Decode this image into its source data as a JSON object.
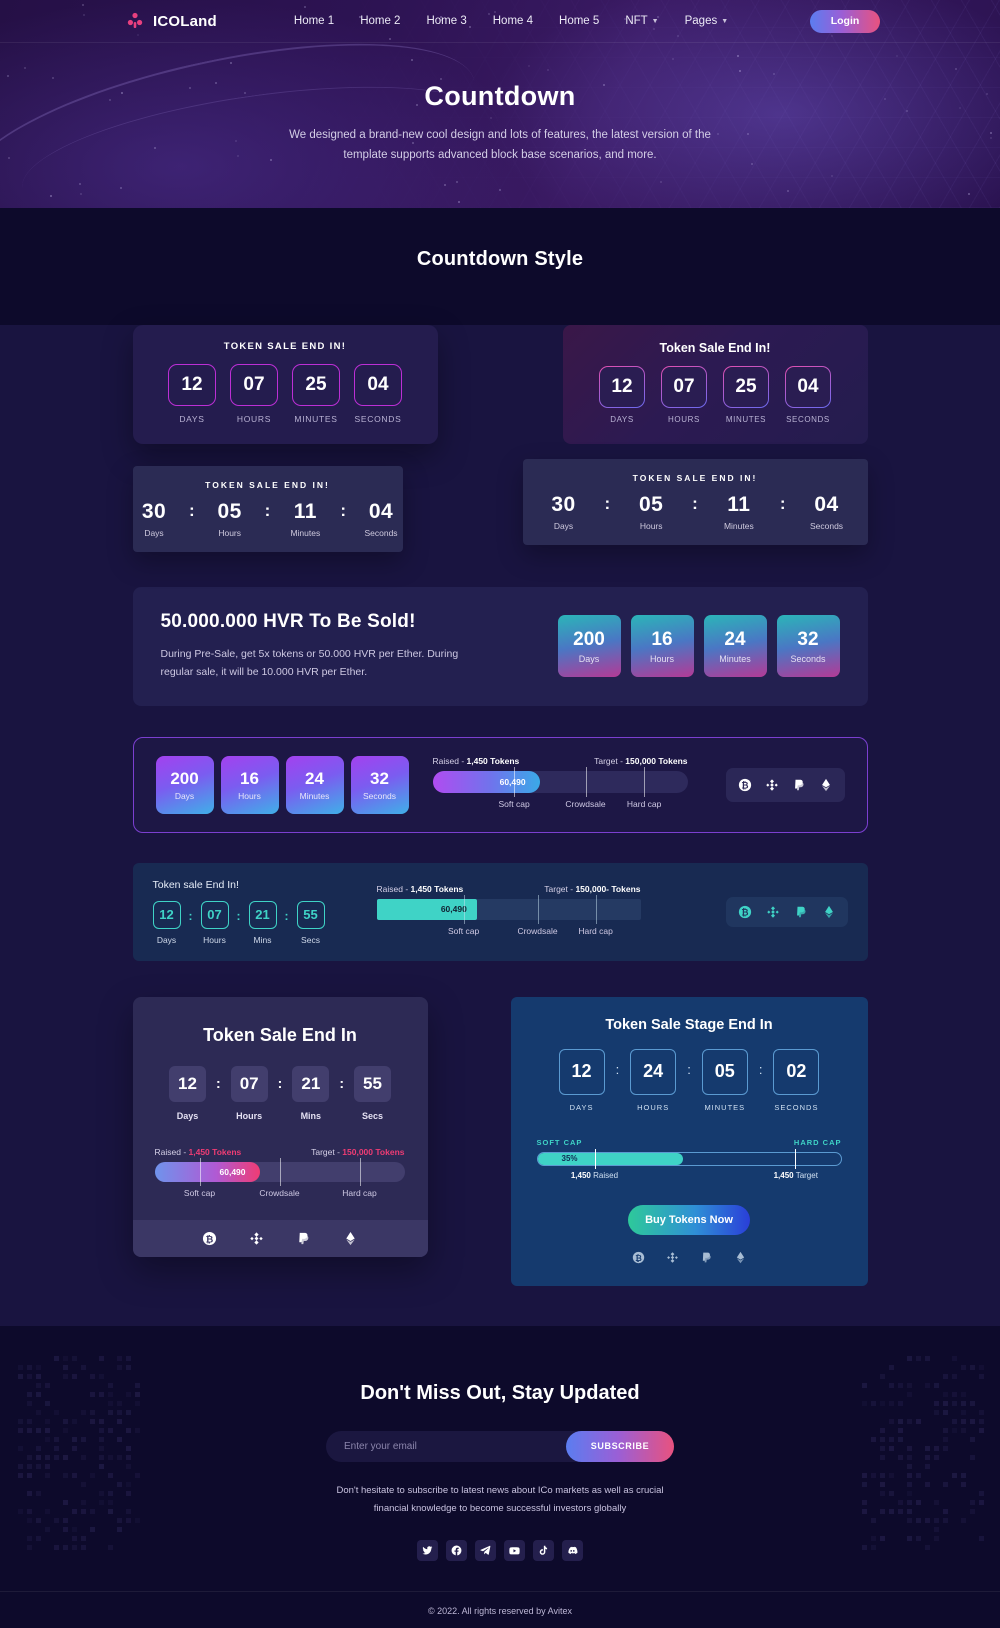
{
  "nav": {
    "brand": "ICOLand",
    "links": [
      {
        "label": "Home 1",
        "caret": false
      },
      {
        "label": "Home 2",
        "caret": false
      },
      {
        "label": "Home 3",
        "caret": false
      },
      {
        "label": "Home 4",
        "caret": false
      },
      {
        "label": "Home 5",
        "caret": false
      },
      {
        "label": "NFT",
        "caret": true
      },
      {
        "label": "Pages",
        "caret": true
      }
    ],
    "login": "Login"
  },
  "hero": {
    "title": "Countdown",
    "subtitle": "We designed a brand-new cool design and lots of features, the latest version of the template supports advanced block base scenarios, and more."
  },
  "section": {
    "title": "Countdown Style"
  },
  "card1": {
    "title": "TOKEN SALE END IN!",
    "units": [
      {
        "value": "12",
        "label": "DAYS"
      },
      {
        "value": "07",
        "label": "HOURS"
      },
      {
        "value": "25",
        "label": "MINUTES"
      },
      {
        "value": "04",
        "label": "SECONDS"
      }
    ]
  },
  "card2": {
    "title": "Token Sale End In!",
    "units": [
      {
        "value": "12",
        "label": "DAYS"
      },
      {
        "value": "07",
        "label": "HOURS"
      },
      {
        "value": "25",
        "label": "MINUTES"
      },
      {
        "value": "04",
        "label": "SECONDS"
      }
    ]
  },
  "card3": {
    "title": "TOKEN SALE END IN!",
    "separator": ":",
    "units": [
      {
        "value": "30",
        "label": "Days"
      },
      {
        "value": "05",
        "label": "Hours"
      },
      {
        "value": "11",
        "label": "Minutes"
      },
      {
        "value": "04",
        "label": "Seconds"
      }
    ]
  },
  "card4": {
    "title": "TOKEN SALE END IN!",
    "separator": ":",
    "units": [
      {
        "value": "30",
        "label": "Days"
      },
      {
        "value": "05",
        "label": "Hours"
      },
      {
        "value": "11",
        "label": "Minutes"
      },
      {
        "value": "04",
        "label": "Seconds"
      }
    ]
  },
  "card5": {
    "heading": "50.000.000 HVR To Be Sold!",
    "paragraph": "During Pre-Sale, get 5x tokens or 50.000 HVR per Ether. During regular sale, it will be 10.000 HVR per Ether.",
    "units": [
      {
        "value": "200",
        "label": "Days"
      },
      {
        "value": "16",
        "label": "Hours"
      },
      {
        "value": "24",
        "label": "Minutes"
      },
      {
        "value": "32",
        "label": "Seconds"
      }
    ]
  },
  "card6": {
    "units": [
      {
        "value": "200",
        "label": "Days"
      },
      {
        "value": "16",
        "label": "Hours"
      },
      {
        "value": "24",
        "label": "Minutes"
      },
      {
        "value": "32",
        "label": "Seconds"
      }
    ],
    "raised_prefix": "Raised - ",
    "raised_value": "1,450 Tokens",
    "target_prefix": "Target - ",
    "target_value": "150,000 Tokens",
    "fill_value": "60,490",
    "fill_percent": 42,
    "marks": [
      "Soft cap",
      "Crowdsale",
      "Hard cap"
    ],
    "payments": [
      "bitcoin-icon",
      "binance-icon",
      "paypal-icon",
      "ethereum-icon"
    ]
  },
  "card7": {
    "title": "Token sale End In!",
    "separator": ":",
    "units": [
      {
        "value": "12",
        "label": "Days"
      },
      {
        "value": "07",
        "label": "Hours"
      },
      {
        "value": "21",
        "label": "Mins"
      },
      {
        "value": "55",
        "label": "Secs"
      }
    ],
    "raised_prefix": "Raised - ",
    "raised_value": "1,450 Tokens",
    "target_prefix": "Target - ",
    "target_value": "150,000- Tokens",
    "fill_value": "60,490",
    "fill_percent": 38,
    "marks": [
      "Soft cap",
      "Crowdsale",
      "Hard cap"
    ],
    "payments": [
      "bitcoin-icon",
      "binance-icon",
      "paypal-icon",
      "ethereum-icon"
    ]
  },
  "card8": {
    "heading": "Token Sale End In",
    "separator": ":",
    "units": [
      {
        "value": "12",
        "label": "Days"
      },
      {
        "value": "07",
        "label": "Hours"
      },
      {
        "value": "21",
        "label": "Mins"
      },
      {
        "value": "55",
        "label": "Secs"
      }
    ],
    "raised_prefix": "Raised - ",
    "raised_value": "1,450 Tokens",
    "target_prefix": "Target - ",
    "target_value": "150,000 Tokens",
    "fill_value": "60,490",
    "fill_percent": 42,
    "marks": [
      "Soft cap",
      "Crowdsale",
      "Hard cap"
    ],
    "payments": [
      "bitcoin-icon",
      "binance-icon",
      "paypal-icon",
      "ethereum-icon"
    ]
  },
  "card9": {
    "heading": "Token Sale Stage End In",
    "separator": ":",
    "units": [
      {
        "value": "12",
        "label": "DAYS"
      },
      {
        "value": "24",
        "label": "HOURS"
      },
      {
        "value": "05",
        "label": "MINUTES"
      },
      {
        "value": "02",
        "label": "SECONDS"
      }
    ],
    "soft_cap": "SOFT CAP",
    "hard_cap": "HARD CAP",
    "fill_value": "35%",
    "fill_percent": 48,
    "raised": "1,450 Raised",
    "raised_bold": "1,450",
    "raised_rest": " Raised",
    "target_bold": "1,450",
    "target_rest": " Target",
    "buy_label": "Buy Tokens Now",
    "payments": [
      "bitcoin-icon",
      "binance-icon",
      "paypal-icon",
      "ethereum-icon"
    ]
  },
  "footer": {
    "heading": "Don't Miss Out, Stay Updated",
    "email_placeholder": "Enter your email",
    "subscribe": "SUBSCRIBE",
    "paragraph": "Don't hesitate to subscribe to latest news about ICo markets as well as crucial financial knowledge to become successful investors globally",
    "socials": [
      "twitter-icon",
      "facebook-icon",
      "telegram-icon",
      "youtube-icon",
      "tiktok-icon",
      "discord-icon"
    ],
    "copyright": "© 2022. All rights reserved by Avitex"
  },
  "colors": {
    "accent_pink": "#e8527f",
    "accent_purple": "#bc2fd5",
    "accent_teal": "#3fd3c6",
    "hero_bg": "#2d1353",
    "page_bg": "#191440"
  }
}
